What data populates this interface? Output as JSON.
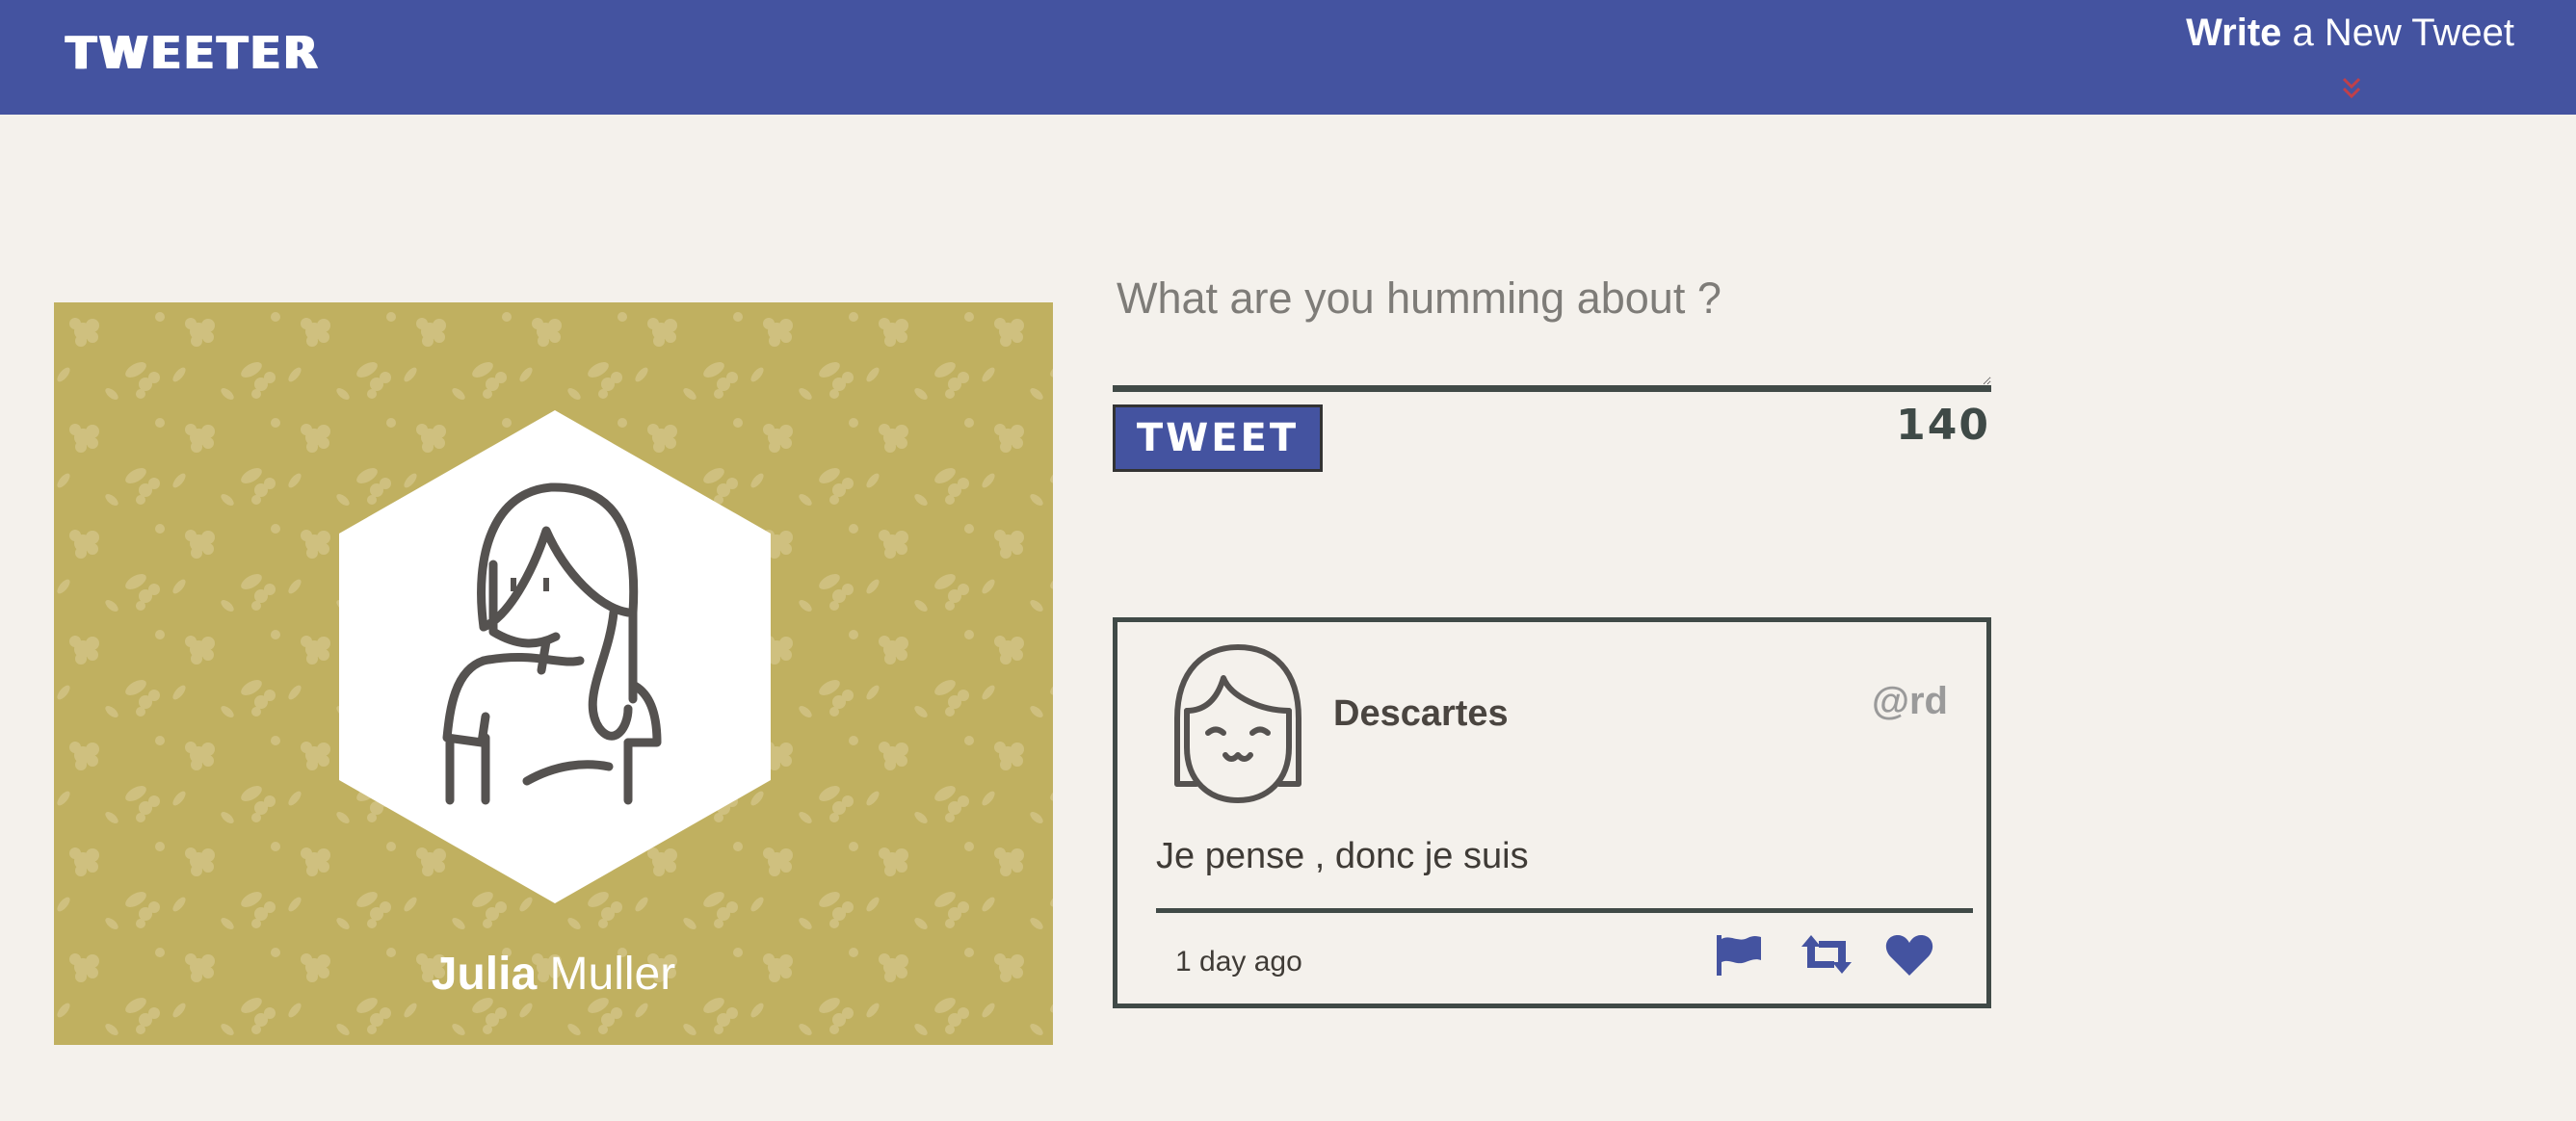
{
  "header": {
    "brand": "TWEETER",
    "compose_bold": "Write",
    "compose_rest": " a New Tweet",
    "bg_color": "#4453a0"
  },
  "profile": {
    "first_name": "Julia",
    "last_name": " Muller",
    "bg_color": "#c0b060"
  },
  "composer": {
    "placeholder": "What are you humming about ?",
    "value": "",
    "button_label": "TWEET",
    "counter": "140"
  },
  "tweets": [
    {
      "author": "Descartes",
      "handle": "@rd",
      "text": "Je pense , donc je suis",
      "time": "1 day ago",
      "actions": [
        "flag-icon",
        "retweet-icon",
        "heart-icon"
      ]
    }
  ],
  "colors": {
    "accent": "#4453a0",
    "dark": "#404a47",
    "chevron": "#c0404a",
    "page_bg": "#f4f1ec"
  }
}
